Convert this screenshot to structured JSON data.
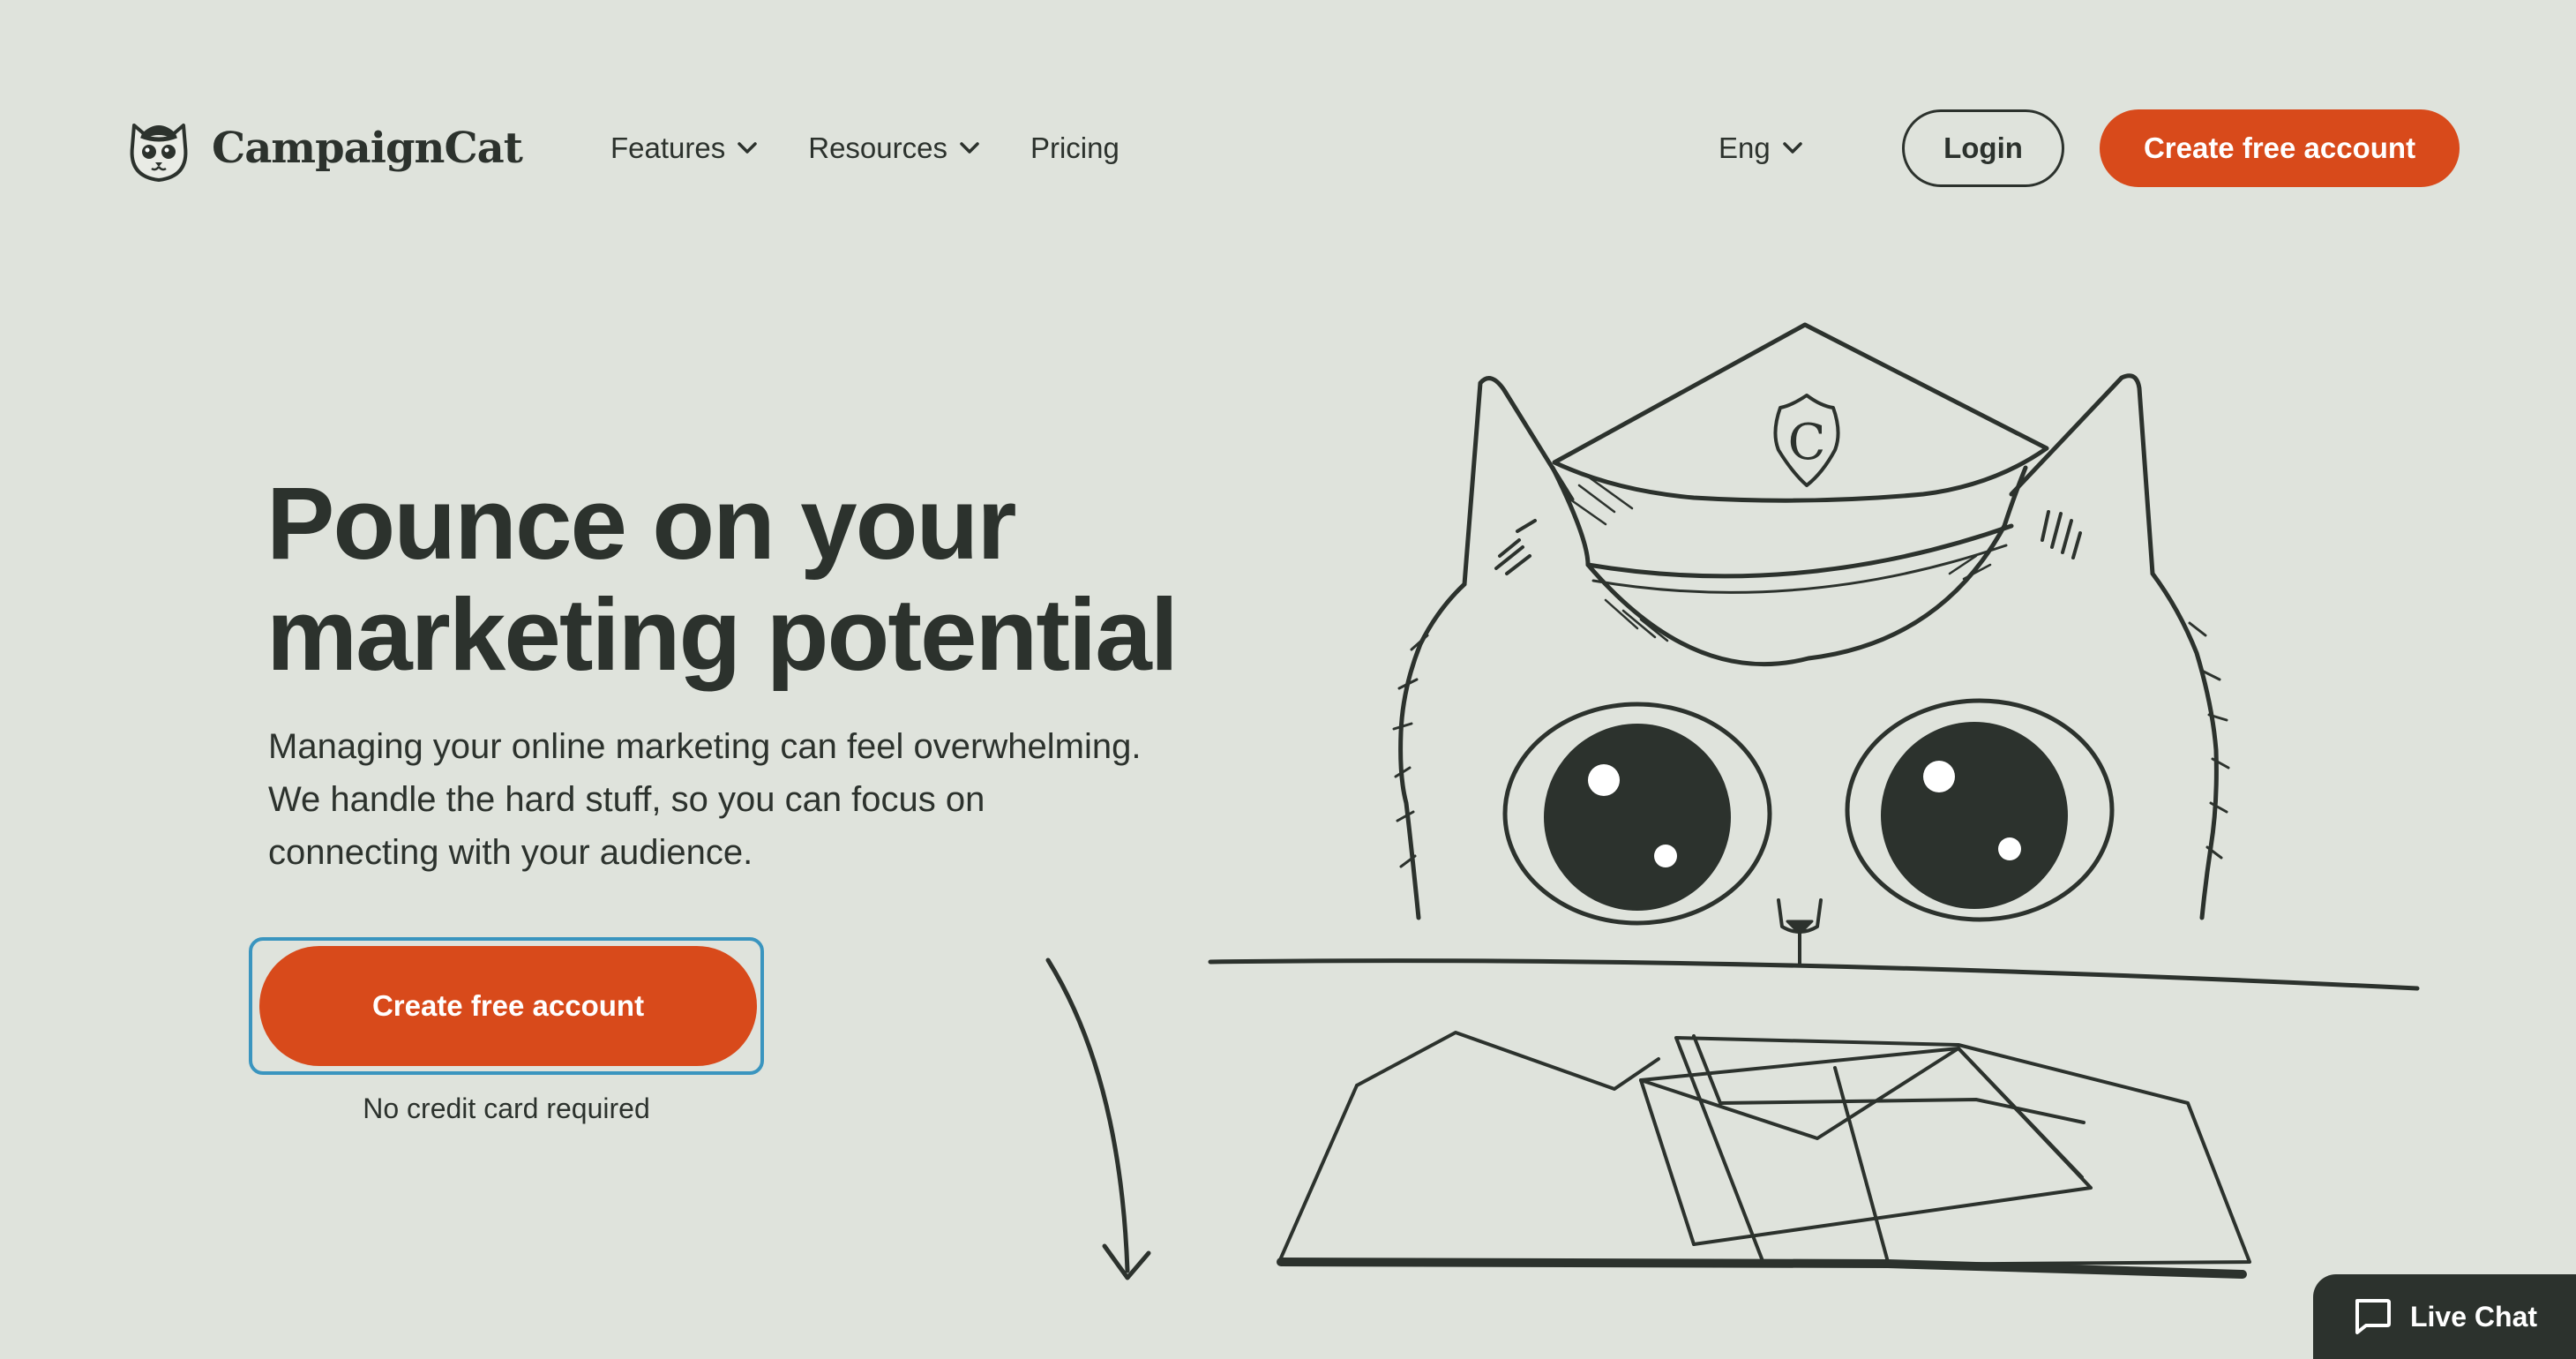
{
  "brand": {
    "name": "CampaignCat",
    "logo_icon": "cat-postman-icon",
    "accent_color": "#d84a1b",
    "ink_color": "#2c322d",
    "background_color": "#dfe3dc",
    "focus_color": "#3a95bf"
  },
  "nav": {
    "items": [
      {
        "label": "Features",
        "has_dropdown": true
      },
      {
        "label": "Resources",
        "has_dropdown": true
      },
      {
        "label": "Pricing",
        "has_dropdown": false
      }
    ],
    "language": "Eng",
    "login_label": "Login",
    "signup_label": "Create free account"
  },
  "hero": {
    "title_line1": "Pounce on your",
    "title_line2": "marketing potential",
    "description_line1": "Managing your online marketing can feel overwhelming.",
    "description_line2": "We handle the hard stuff, so you can focus on",
    "description_line3": "connecting with your audience.",
    "cta_label": "Create free account",
    "cta_note": "No credit card required",
    "illustration": "cat-with-postman-hat-and-envelopes",
    "badge_letter": "C"
  },
  "live_chat": {
    "label": "Live Chat",
    "icon": "chat-bubble-icon"
  }
}
